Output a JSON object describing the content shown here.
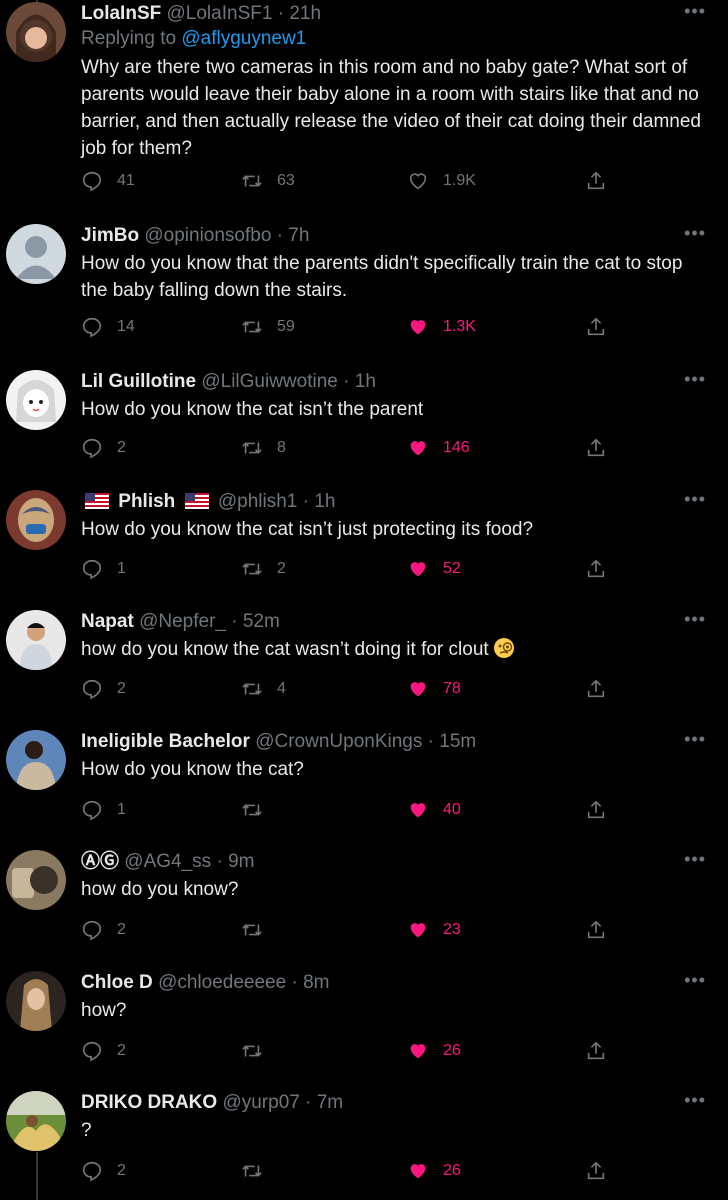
{
  "tweets": [
    {
      "name": "LolaInSF",
      "handle": "@LolaInSF1",
      "time": "21h",
      "replying_prefix": "Replying to",
      "replying_handle": "@aflyguynew1",
      "text": "Why are there two cameras in this room and no baby gate? What sort of parents would leave their baby alone in a room with stairs like that and no barrier, and then actually release the video of their cat doing their damned job for them?",
      "replies": "41",
      "retweets": "63",
      "likes": "1.9K",
      "liked": false
    },
    {
      "name": "JimBo",
      "handle": "@opinionsofbo",
      "time": "7h",
      "text": "How do you know that the parents didn't specifically train the cat to stop the baby falling down the stairs.",
      "replies": "14",
      "retweets": "59",
      "likes": "1.3K",
      "liked": true
    },
    {
      "name": "Lil Guillotine",
      "handle": "@LilGuiwwotine",
      "time": "1h",
      "text": "How do you know the cat isn’t the parent",
      "replies": "2",
      "retweets": "8",
      "likes": "146",
      "liked": true
    },
    {
      "name": "Phlish",
      "handle": "@phlish1",
      "time": "1h",
      "text": "How do you know the cat isn’t just protecting its food?",
      "replies": "1",
      "retweets": "2",
      "likes": "52",
      "liked": true
    },
    {
      "name": "Napat",
      "handle": "@Nepfer_",
      "time": "52m",
      "text": "how do you know the cat wasn’t doing it for clout",
      "replies": "2",
      "retweets": "4",
      "likes": "78",
      "liked": true
    },
    {
      "name": "Ineligible Bachelor",
      "handle": "@CrownUponKings",
      "time": "15m",
      "text": "How do you know the cat?",
      "replies": "1",
      "retweets": "",
      "likes": "40",
      "liked": true
    },
    {
      "name": "ⒶⒼ",
      "handle": "@AG4_ss",
      "time": "9m",
      "text": "how do you know?",
      "replies": "2",
      "retweets": "",
      "likes": "23",
      "liked": true
    },
    {
      "name": "Chloe D",
      "handle": "@chloedeeeee",
      "time": "8m",
      "text": "how?",
      "replies": "2",
      "retweets": "",
      "likes": "26",
      "liked": true
    },
    {
      "name": "DRIKO DRAKO",
      "handle": "@yurp07",
      "time": "7m",
      "text": "?",
      "replies": "2",
      "retweets": "",
      "likes": "26",
      "liked": true
    }
  ],
  "separator": "·",
  "more_icon": "•••",
  "colors": {
    "background": "#000000",
    "text": "#e7e9ea",
    "muted": "#71767b",
    "link": "#1d9bf0",
    "like": "#f91880"
  }
}
